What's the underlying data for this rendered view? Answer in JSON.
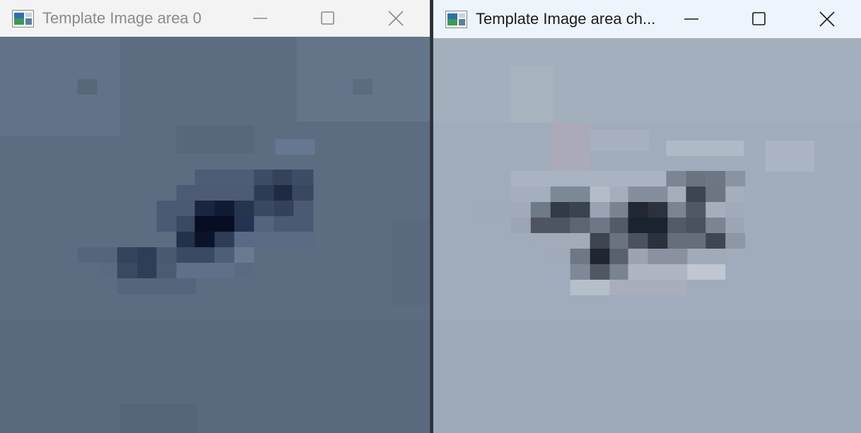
{
  "windows": [
    {
      "title": "Template Image area 0",
      "state": "inactive",
      "caption_buttons": [
        "minimize-icon",
        "maximize-icon",
        "close-icon"
      ]
    },
    {
      "title": "Template Image area ch...",
      "state": "active",
      "caption_buttons": [
        "minimize-icon",
        "maximize-icon",
        "close-icon"
      ]
    }
  ],
  "colors": {
    "left_image_base": "#5b6a7e",
    "left_image_dark": "#0b1328",
    "right_image_base": "#a2adbd",
    "right_image_dark": "#1a2330"
  }
}
